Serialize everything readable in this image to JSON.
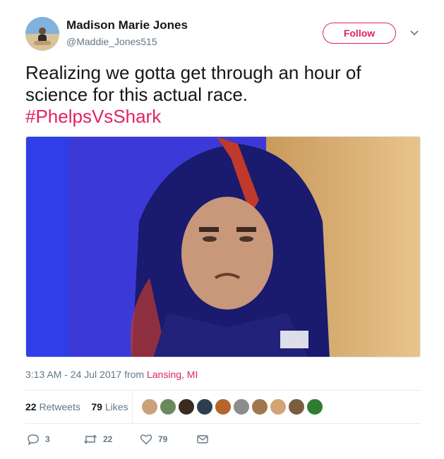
{
  "author": {
    "name": "Madison Marie Jones",
    "handle": "@Maddie_Jones515"
  },
  "follow_label": "Follow",
  "tweet": {
    "text": "Realizing we gotta get through an hour of science for this actual race.",
    "hashtag": "#PhelpsVsShark"
  },
  "meta": {
    "time": "3:13 AM - 24 Jul 2017 from ",
    "location": "Lansing, MI"
  },
  "stats": {
    "retweets_count": "22",
    "retweets_label": "Retweets",
    "likes_count": "79",
    "likes_label": "Likes"
  },
  "likers": [
    "#c9a27a",
    "#6b8a5c",
    "#3a2a20",
    "#2c3e50",
    "#b5652e",
    "#8c8c8c",
    "#a07850",
    "#d4a373",
    "#7a5c3e",
    "#2e7d32"
  ],
  "actions": {
    "replies": "3",
    "retweets": "22",
    "likes": "79"
  },
  "colors": {
    "accent": "#e0245e",
    "secondary": "#657786"
  },
  "icons": {
    "caret": "chevron-down-icon",
    "reply": "reply-icon",
    "retweet": "retweet-icon",
    "like": "heart-icon",
    "dm": "envelope-icon"
  }
}
